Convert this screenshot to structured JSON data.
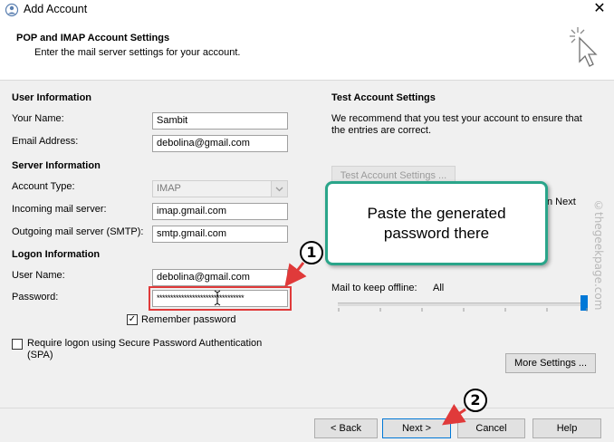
{
  "window": {
    "title": "Add Account",
    "close_glyph": "✕"
  },
  "header": {
    "title": "POP and IMAP Account Settings",
    "subtitle": "Enter the mail server settings for your account."
  },
  "user_info": {
    "heading": "User Information",
    "your_name_label": "Your Name:",
    "your_name_value": "Sambit",
    "email_label": "Email Address:",
    "email_value": "debolina@gmail.com"
  },
  "server_info": {
    "heading": "Server Information",
    "account_type_label": "Account Type:",
    "account_type_value": "IMAP",
    "incoming_label": "Incoming mail server:",
    "incoming_value": "imap.gmail.com",
    "outgoing_label": "Outgoing mail server (SMTP):",
    "outgoing_value": "smtp.gmail.com"
  },
  "logon_info": {
    "heading": "Logon Information",
    "user_name_label": "User Name:",
    "user_name_value": "debolina@gmail.com",
    "password_label": "Password:",
    "password_value": "********************************",
    "remember_label": "Remember password",
    "remember_checked": true,
    "spa_label_1": "Require logon using Secure Password Authentication",
    "spa_label_2": "(SPA)",
    "spa_checked": false
  },
  "test_settings": {
    "heading": "Test Account Settings",
    "desc_1": "We recommend that you test your account to ensure that",
    "desc_2": "the entries are correct.",
    "test_button": "Test Account Settings ...",
    "partial_next_text": "n Next"
  },
  "offline": {
    "label": "Mail to keep offline:",
    "value": "All",
    "slider_level": 1.0
  },
  "more_settings_button": "More Settings ...",
  "footer": {
    "back": "< Back",
    "next": "Next >",
    "cancel": "Cancel",
    "help": "Help"
  },
  "annotations": {
    "callout_line1": "Paste the generated",
    "callout_line2": "password there",
    "step1": "1",
    "step2": "2",
    "accent_color": "#e03a3a",
    "callout_border": "#2aa58a"
  },
  "watermark": "©thegeekpage.com",
  "icons": {
    "app_icon": "outlook-account-icon",
    "wizard_icon": "cursor-sparkle-icon",
    "dropdown_icon": "chevron-down-icon"
  }
}
